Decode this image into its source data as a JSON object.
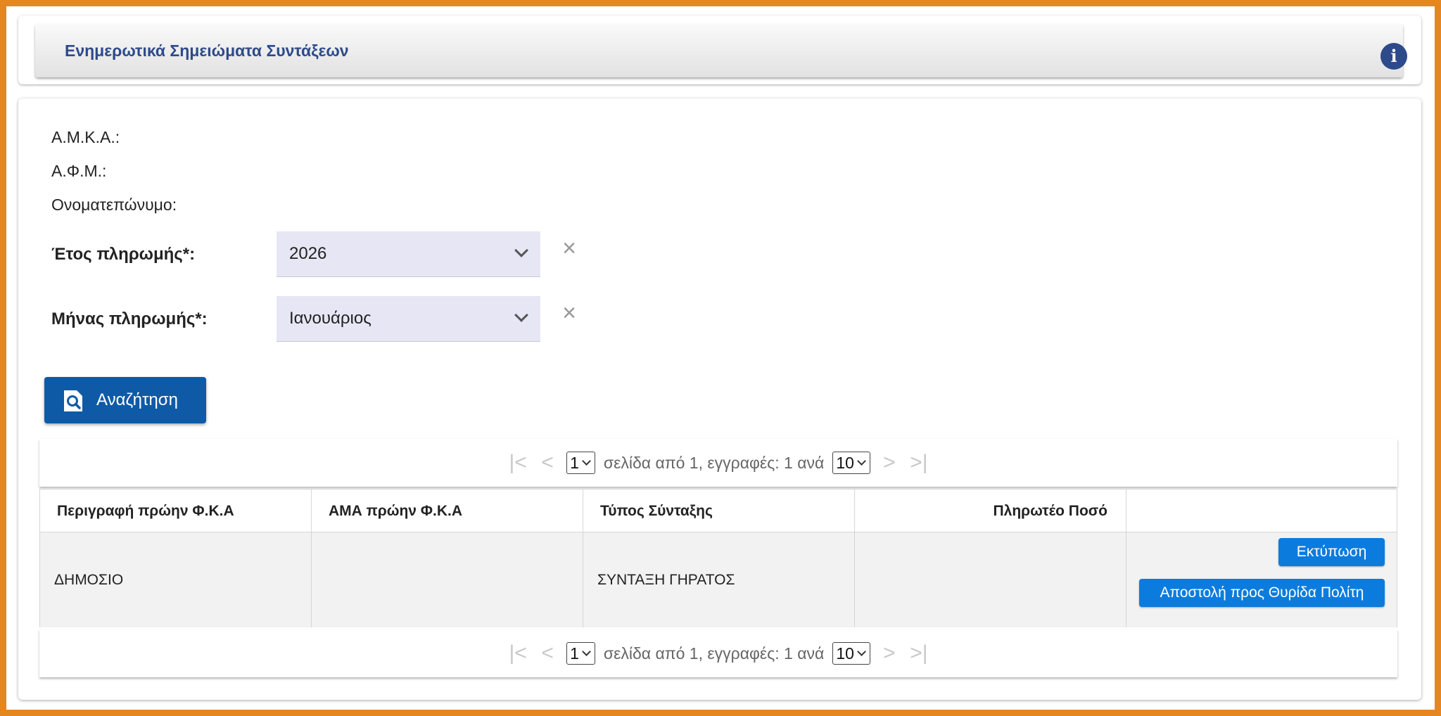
{
  "header": {
    "title": "Ενημερωτικά Σημειώματα Συντάξεων",
    "info_icon": "info-icon"
  },
  "details": {
    "amka_label": "Α.Μ.Κ.Α.:",
    "afm_label": "Α.Φ.Μ.:",
    "fullname_label": "Ονοματεπώνυμο:"
  },
  "filters": {
    "year_label": "Έτος πληρωμής*:",
    "year_value": "2026",
    "month_label": "Μήνας πληρωμής*:",
    "month_value": "Ιανουάριος",
    "clear_symbol": "×"
  },
  "search_button": {
    "label": "Αναζήτηση",
    "icon": "search-document-icon"
  },
  "pager": {
    "page_value": "1",
    "info_text": "σελίδα από 1, εγγραφές: 1 ανά",
    "page_size": "10",
    "first_icon": "|<",
    "prev_icon": "<",
    "next_icon": ">",
    "last_icon": ">|"
  },
  "table": {
    "columns": [
      "Περιγραφή πρώην Φ.Κ.Α",
      "ΑΜΑ πρώην Φ.Κ.Α",
      "Τύπος Σύνταξης",
      "Πληρωτέο Ποσό",
      ""
    ],
    "rows": [
      {
        "description": "ΔΗΜΟΣΙΟ",
        "ama": "",
        "pension_type": "ΣΥΝΤΑΞΗ ΓΗΡΑΤΟΣ",
        "amount": ""
      }
    ],
    "print_button": "Εκτύπωση",
    "send_button": "Αποστολή προς Θυρίδα Πολίτη"
  },
  "colors": {
    "frame": "#e5861f",
    "title": "#2d4a8a",
    "select_bg": "#e6e6f5",
    "search_button": "#0f5aa6",
    "action_button": "#0b7cde"
  }
}
